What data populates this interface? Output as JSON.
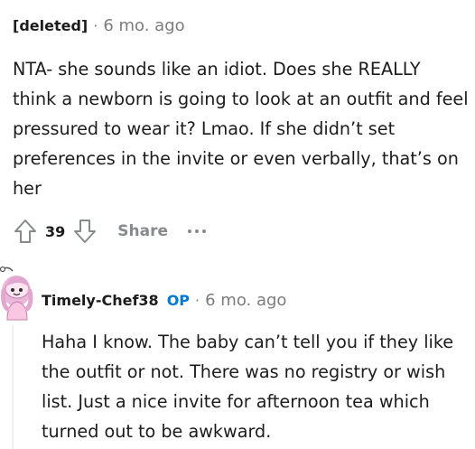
{
  "comment1": {
    "author": "[deleted]",
    "separator": "·",
    "timestamp": "6 mo. ago",
    "body": "NTA- she sounds like an idiot. Does she REALLY think a newborn is going to look at an outfit and feel pressured to wear it? Lmao. If she didn’t set preferences in the invite or even verbally, that’s on her",
    "vote_count": "39",
    "share_label": "Share",
    "icons": {
      "upvote": "arrow-up-icon",
      "downvote": "arrow-down-icon",
      "more": "more-horizontal-icon"
    }
  },
  "comment2": {
    "author": "Timely-Chef38",
    "op_badge": "OP",
    "separator": "·",
    "timestamp": "6 mo. ago",
    "body": "Haha I know. The baby can’t tell you if they like the outfit or not. There was no registry or wish list. Just a nice invite for afternoon tea which turned out to be awkward.",
    "avatar_icon": "snoo-avatar-icon"
  },
  "colors": {
    "text": "#1c1c1c",
    "meta": "#7c7c7c",
    "action": "#878a8c",
    "op": "#0079d3",
    "thread_line": "#edeff1"
  }
}
